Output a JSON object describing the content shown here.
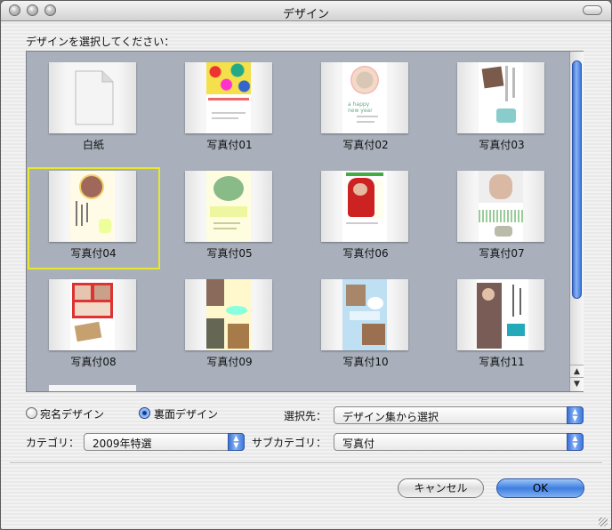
{
  "window": {
    "title": "デザイン"
  },
  "prompt": "デザインを選択してください：",
  "designs": [
    {
      "label": "白紙"
    },
    {
      "label": "写真付01"
    },
    {
      "label": "写真付02"
    },
    {
      "label": "写真付03"
    },
    {
      "label": "写真付04"
    },
    {
      "label": "写真付05"
    },
    {
      "label": "写真付06"
    },
    {
      "label": "写真付07"
    },
    {
      "label": "写真付08"
    },
    {
      "label": "写真付09"
    },
    {
      "label": "写真付10"
    },
    {
      "label": "写真付11"
    }
  ],
  "selected_design": "写真付04",
  "side": {
    "options": [
      "宛名デザイン",
      "裏面デザイン"
    ],
    "selected": "裏面デザイン"
  },
  "source": {
    "label": "選択先：",
    "value": "デザイン集から選択"
  },
  "category": {
    "label": "カテゴリ：",
    "value": "2009年特選"
  },
  "subcategory": {
    "label": "サブカテゴリ：",
    "value": "写真付"
  },
  "buttons": {
    "cancel": "キャンセル",
    "ok": "OK"
  },
  "colors": {
    "selection": "#e8e82a",
    "accent": "#3d78de",
    "grid_bg": "#a9b0bc"
  }
}
